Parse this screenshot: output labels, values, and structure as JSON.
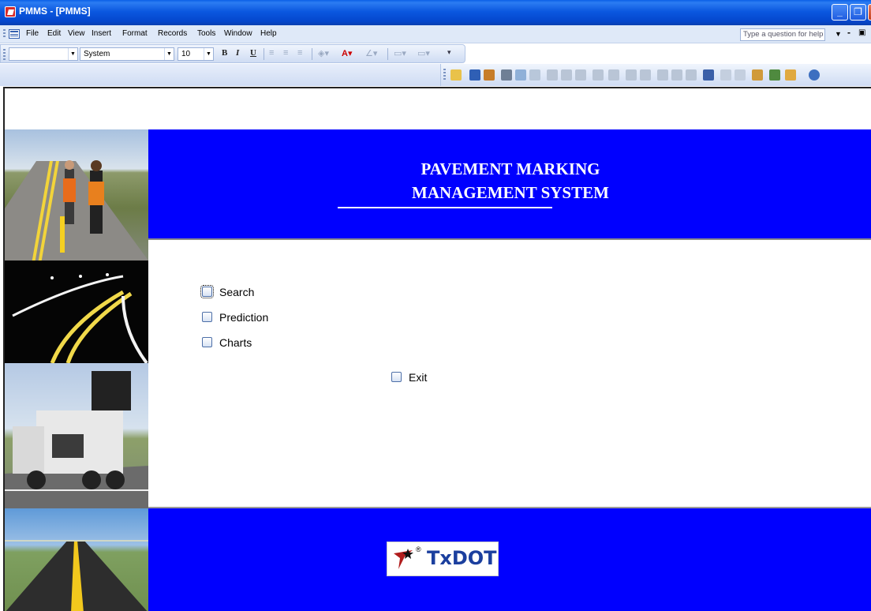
{
  "window": {
    "title": "PMMS - [PMMS]",
    "minimize": "_",
    "maximize": "❐",
    "close": "✕"
  },
  "menubar": {
    "items": [
      "File",
      "Edit",
      "View",
      "Insert",
      "Format",
      "Records",
      "Tools",
      "Window",
      "Help"
    ],
    "help_placeholder": "Type a question for help"
  },
  "format_toolbar": {
    "object_combo": "",
    "font_name": "System",
    "font_size": "10",
    "bold": "B",
    "italic": "I",
    "underline": "U"
  },
  "form": {
    "title_line1": "PAVEMENT MARKING",
    "title_line2": "MANAGEMENT SYSTEM",
    "options": [
      {
        "label": "Search"
      },
      {
        "label": "Prediction"
      },
      {
        "label": "Charts"
      }
    ],
    "exit_label": "Exit",
    "logo_text": "TxDOT",
    "logo_reg": "®"
  },
  "colors": {
    "banner": "#0000ff",
    "titlebar": "#0a5fe6",
    "menubar": "#dfe9f8"
  }
}
